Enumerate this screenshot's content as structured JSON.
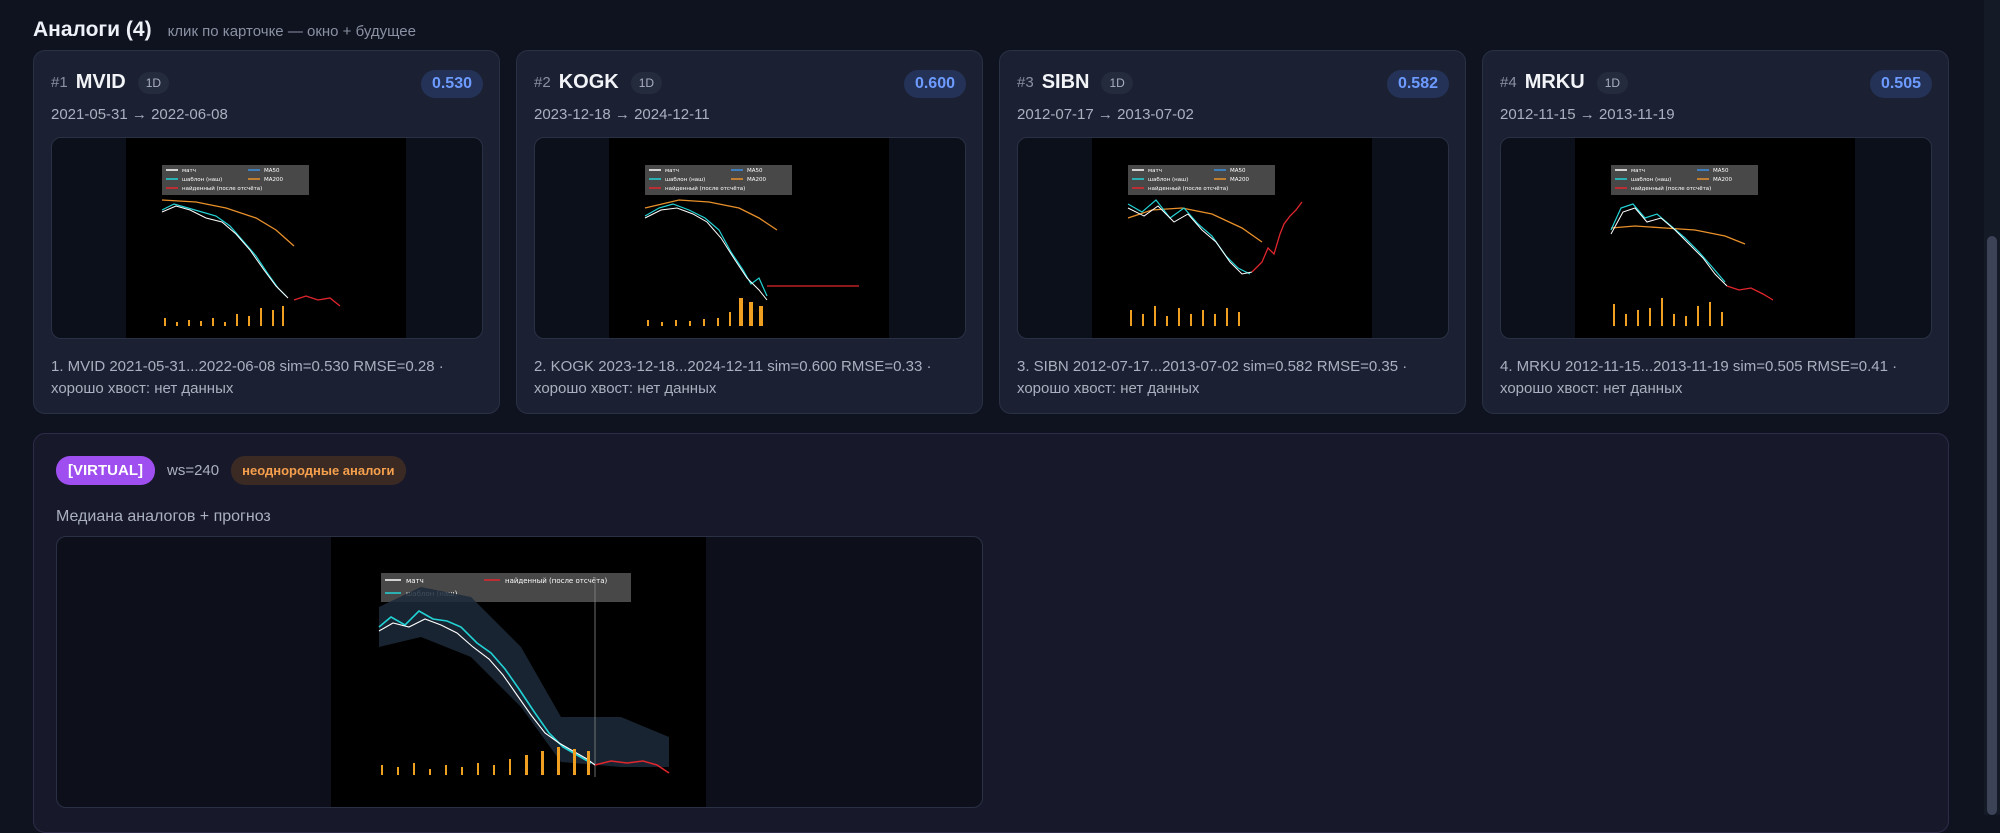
{
  "section": {
    "title": "Аналоги (4)",
    "hint": "клик по карточке — окно + будущее"
  },
  "legend": {
    "match": "матч",
    "template": "шаблон (наш)",
    "found": "найденный (после отсчёта)",
    "ma50": "MA50",
    "ma200": "MA200"
  },
  "cards": [
    {
      "rank": "#1",
      "ticker": "MVID",
      "tf": "1D",
      "sim": "0.530",
      "dates": "2021-05-31 → 2022-06-08",
      "desc": "1. MVID 2021-05-31...2022-06-08 sim=0.530 RMSE=0.28 · хорошо хвост: нет данных"
    },
    {
      "rank": "#2",
      "ticker": "KOGK",
      "tf": "1D",
      "sim": "0.600",
      "dates": "2023-12-18 → 2024-12-11",
      "desc": "2. KOGK 2023-12-18...2024-12-11 sim=0.600 RMSE=0.33 · хорошо хвост: нет данных"
    },
    {
      "rank": "#3",
      "ticker": "SIBN",
      "tf": "1D",
      "sim": "0.582",
      "dates": "2012-07-17 → 2013-07-02",
      "desc": "3. SIBN 2012-07-17...2013-07-02 sim=0.582 RMSE=0.35 · хорошо хвост: нет данных"
    },
    {
      "rank": "#4",
      "ticker": "MRKU",
      "tf": "1D",
      "sim": "0.505",
      "dates": "2012-11-15 → 2013-11-19",
      "desc": "4. MRKU 2012-11-15...2013-11-19 sim=0.505 RMSE=0.41 · хорошо хвост: нет данных"
    }
  ],
  "virtual": {
    "badge": "[VIRTUAL]",
    "ws": "ws=240",
    "tag": "неоднородные аналоги",
    "caption": "Медиана аналогов + прогноз",
    "legend": {
      "match": "матч",
      "template": "шаблон (наш)",
      "found": "найденный (после отсчёта)"
    }
  },
  "colors": {
    "match": "#ffffff",
    "template": "#22d3d6",
    "found": "#e0262d",
    "ma50": "#3a8fe0",
    "ma200": "#e8902a",
    "volume": "#f0a020",
    "sim_badge": "#6d9bff",
    "virtual_badge": "#9f4ef0"
  }
}
